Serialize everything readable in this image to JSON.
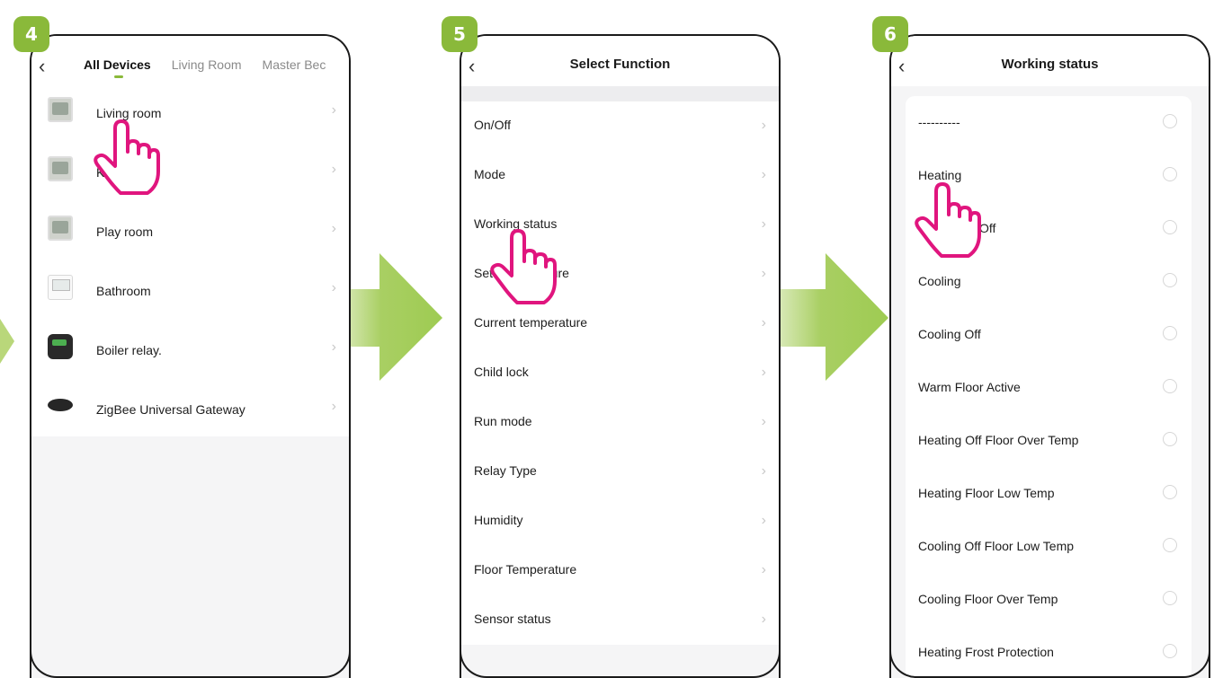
{
  "steps": [
    "4",
    "5",
    "6"
  ],
  "screen4": {
    "tabs": [
      "All Devices",
      "Living Room",
      "Master Bec"
    ],
    "active_tab_index": 0,
    "devices": [
      {
        "name": "Living room",
        "thumb": "thermostat-lcd"
      },
      {
        "name": "K",
        "thumb": "thermostat-lcd"
      },
      {
        "name": "Play room",
        "thumb": "thermostat-lcd"
      },
      {
        "name": "Bathroom",
        "thumb": "thermostat-white"
      },
      {
        "name": "Boiler relay.",
        "thumb": "relay-box"
      },
      {
        "name": "ZigBee Universal Gateway",
        "thumb": "gateway-puck"
      }
    ]
  },
  "screen5": {
    "title": "Select Function",
    "functions": [
      "On/Off",
      "Mode",
      "Working status",
      "Set",
      "Current temperature",
      "Child lock",
      "Run mode",
      "Relay Type",
      "Humidity",
      "Floor Temperature",
      "Sensor status"
    ],
    "obscured_suffix": "ature"
  },
  "screen6": {
    "title": "Working status",
    "options": [
      "----------",
      "Heating",
      "Off",
      "Cooling",
      "Cooling Off",
      "Warm Floor Active",
      "Heating Off Floor Over Temp",
      "Heating Floor Low Temp",
      "Cooling Off Floor Low Temp",
      "Cooling Floor Over Temp",
      "Heating Frost Protection"
    ]
  },
  "icons": {
    "back": "chevron-left-icon",
    "row_chevron": "chevron-right-icon",
    "pointer": "pointing-hand-icon",
    "flow_arrow": "arrow-right-icon"
  },
  "colors": {
    "accent_green": "#8ab93a",
    "hand_magenta": "#e0157e"
  }
}
